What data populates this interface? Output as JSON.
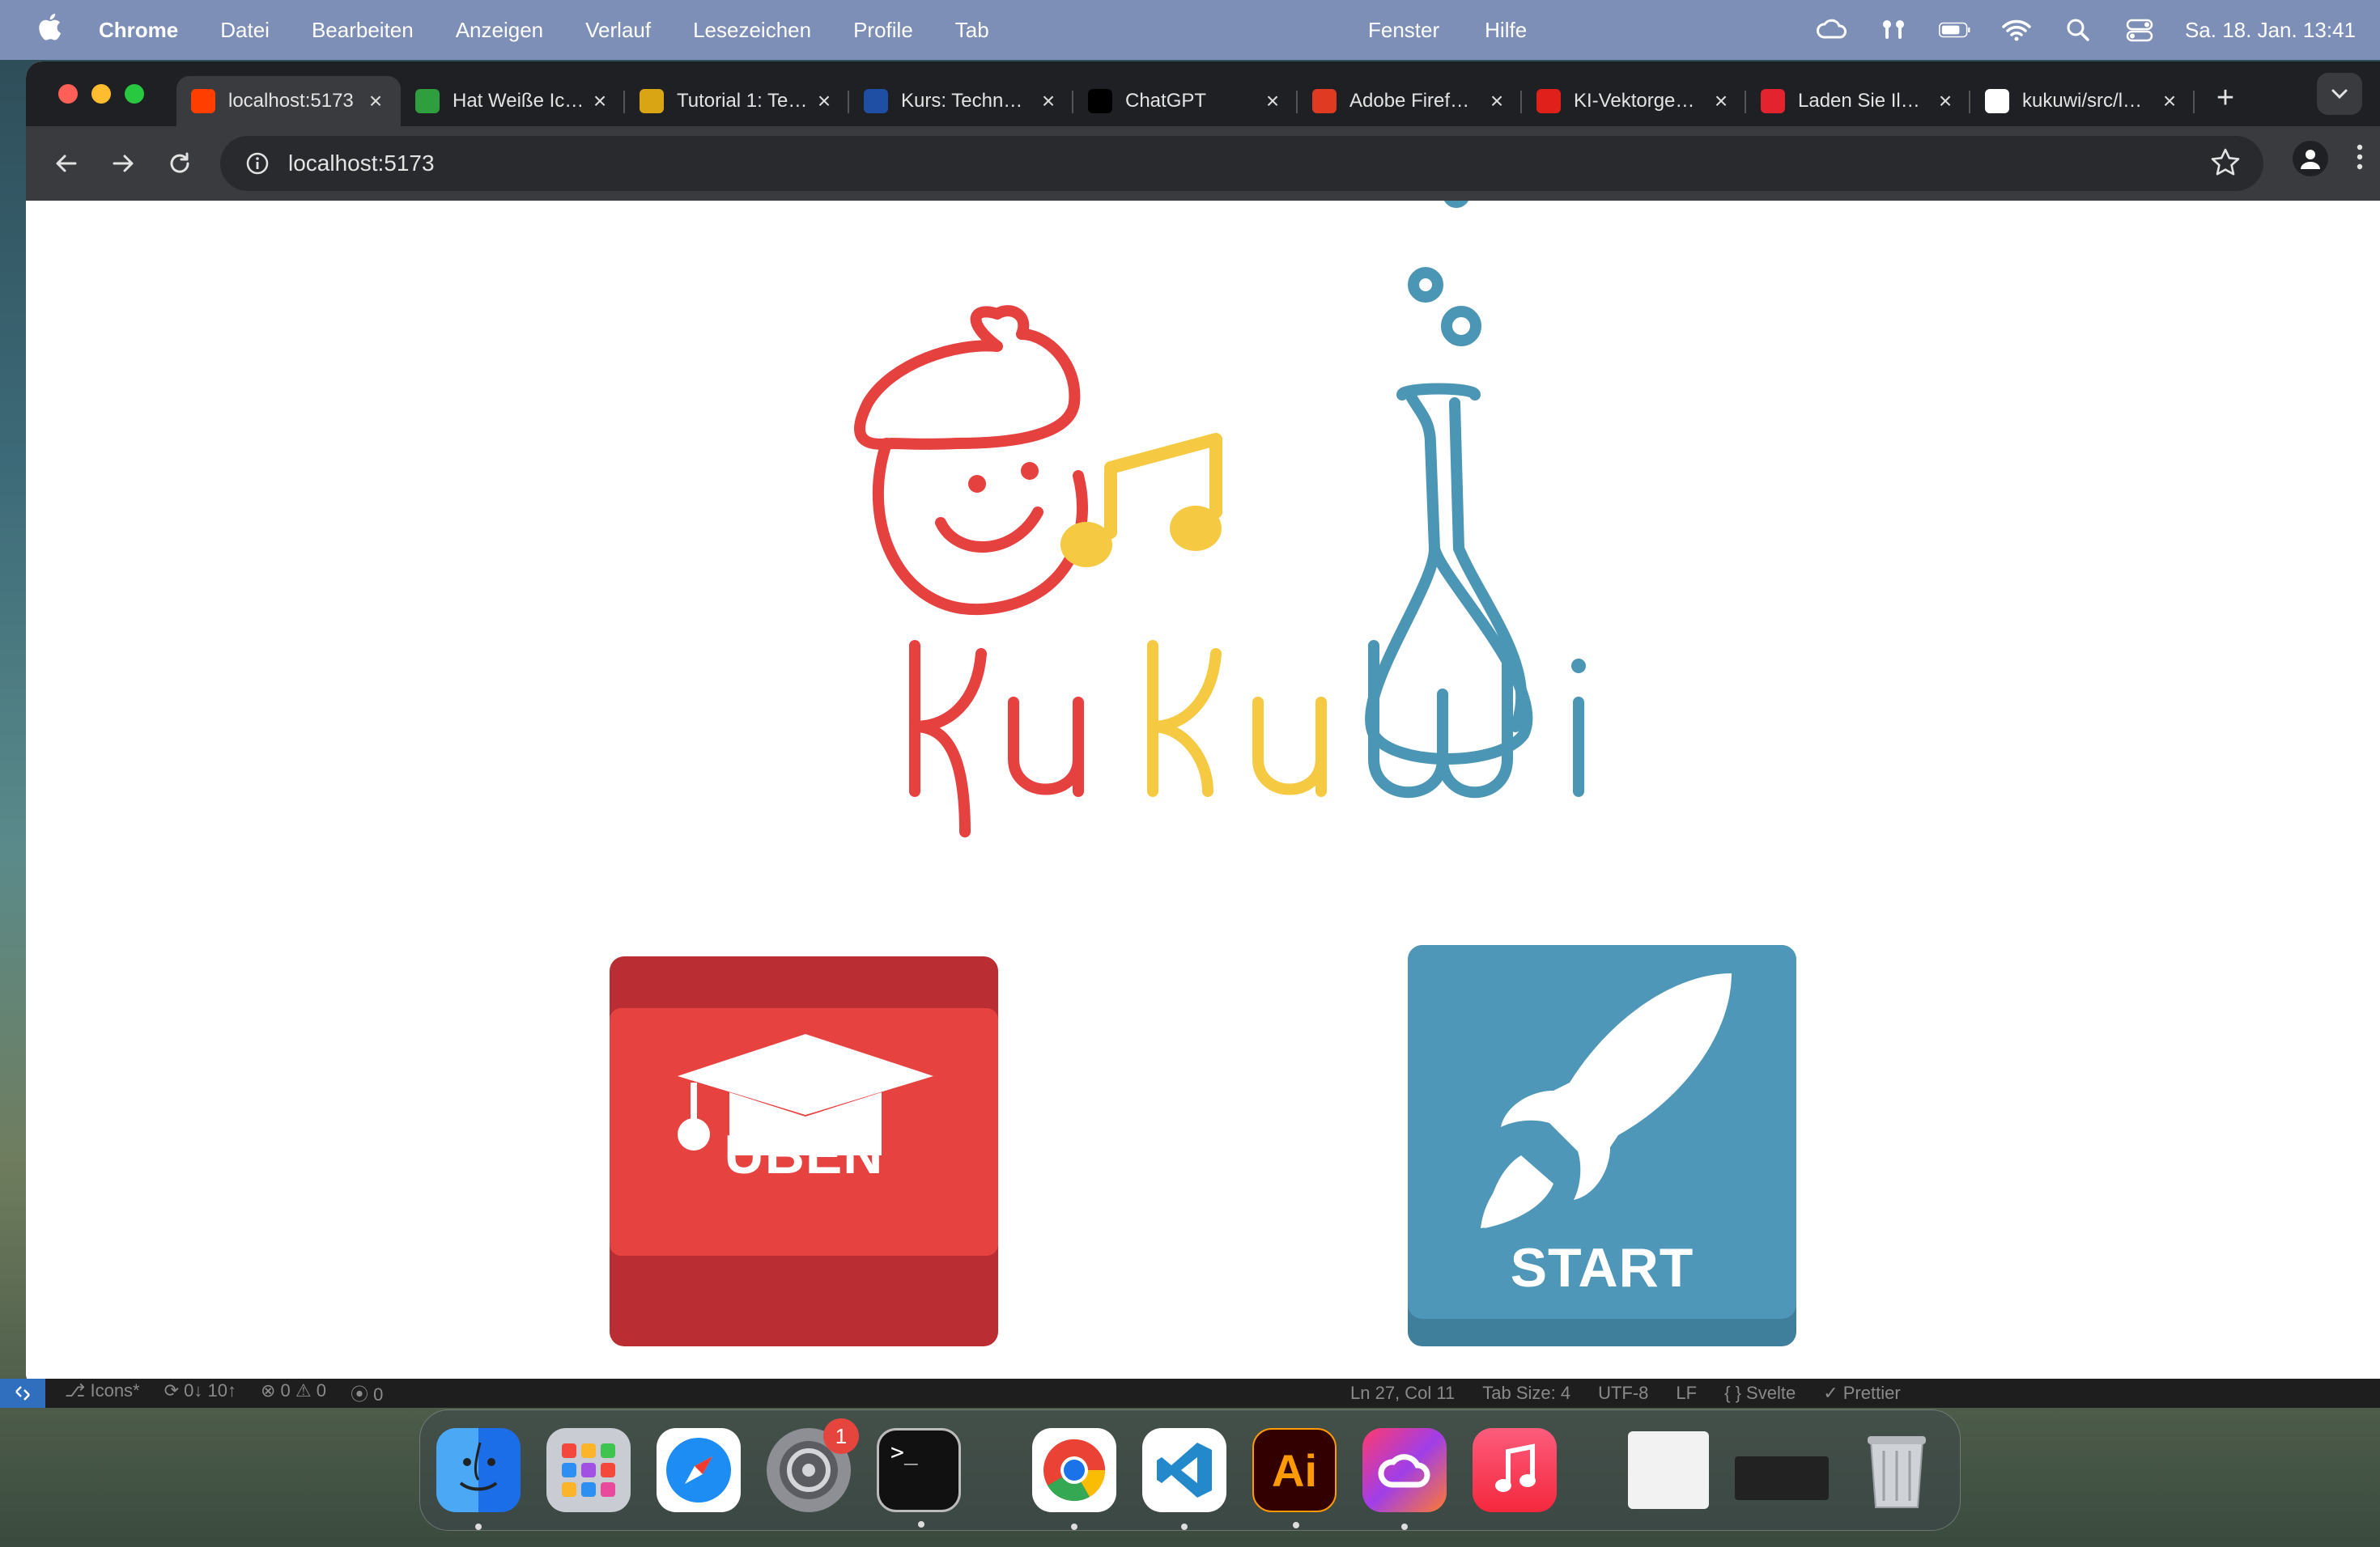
{
  "menubar": {
    "app_name": "Chrome",
    "items": [
      "Datei",
      "Bearbeiten",
      "Anzeigen",
      "Verlauf",
      "Lesezeichen",
      "Profile",
      "Tab"
    ],
    "center_items": [
      "Fenster",
      "Hilfe"
    ],
    "clock": "Sa. 18. Jan.  13:41"
  },
  "tabs": [
    {
      "title": "localhost:5173",
      "favicon": "svelte-icon",
      "color": "#ff3e00",
      "active": true
    },
    {
      "title": "Hat Weiße Ic…",
      "favicon": "green-square-icon",
      "color": "#2e9e3e"
    },
    {
      "title": "Tutorial 1: Te…",
      "favicon": "tutorial-icon",
      "color": "#d9a514"
    },
    {
      "title": "Kurs: Techn…",
      "favicon": "globe-icon",
      "color": "#1f4fa5"
    },
    {
      "title": "ChatGPT",
      "favicon": "openai-icon",
      "color": "#000000"
    },
    {
      "title": "Adobe Firef…",
      "favicon": "adobe-firefly-icon",
      "color": "#e03a22"
    },
    {
      "title": "KI-Vektorge…",
      "favicon": "adobe-icon",
      "color": "#e0201b"
    },
    {
      "title": "Laden Sie Il…",
      "favicon": "refresh-red-icon",
      "color": "#e3232e"
    },
    {
      "title": "kukuwi/src/l…",
      "favicon": "github-icon",
      "color": "#ffffff"
    }
  ],
  "omnibox": {
    "url": "localhost:5173"
  },
  "page": {
    "logo_text": "KuKuWi",
    "logo_parts": [
      "Ku",
      "Ku",
      "Wi"
    ],
    "ueben_label": "ÜBEN",
    "start_label": "START"
  },
  "colors": {
    "red": "#e5413f",
    "yellow": "#f6c943",
    "blue": "#4b96b4"
  },
  "vscode_status": {
    "branch": "Icons*",
    "sync": "0↓ 10↑",
    "problems": "⊗ 0 ⚠ 0",
    "ports": "0",
    "cursor": "Ln 27, Col 11",
    "tab_size": "Tab Size: 4",
    "encoding": "UTF-8",
    "eol": "LF",
    "language": "{ } Svelte",
    "formatter": "✓ Prettier"
  },
  "dock": {
    "apps": [
      "finder-icon",
      "launchpad-icon",
      "safari-icon",
      "system-settings-icon",
      "terminal-icon",
      "chrome-icon",
      "vscode-icon",
      "illustrator-icon",
      "creative-cloud-icon",
      "music-icon"
    ],
    "settings_badge": "1",
    "illustrator_label": "Ai"
  }
}
